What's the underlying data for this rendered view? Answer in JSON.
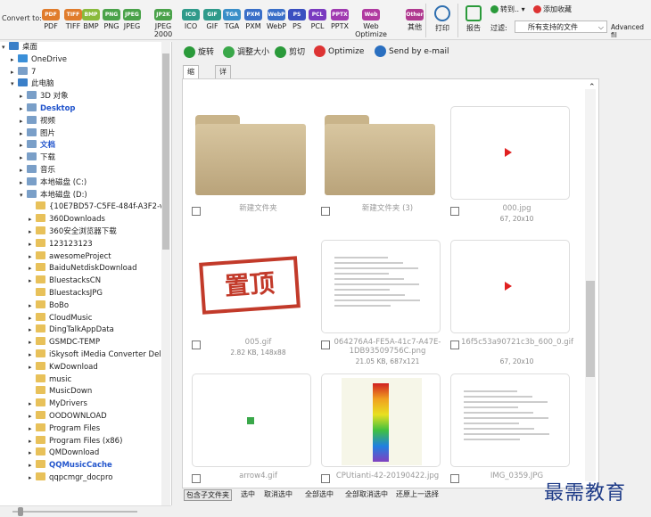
{
  "toolbar": {
    "convert_label": "Convert to:",
    "formats": [
      {
        "label": "PDF",
        "badge": "PDF",
        "color": "#e07c2c"
      },
      {
        "label": "TIFF",
        "badge": "TIFF",
        "color": "#e07c2c"
      },
      {
        "label": "BMP",
        "badge": "BMP",
        "color": "#8aba3c"
      },
      {
        "label": "PNG",
        "badge": "PNG",
        "color": "#4aa24a"
      },
      {
        "label": "JPEG",
        "badge": "JPEG",
        "color": "#4aa24a"
      },
      {
        "label": "JPEG 2000",
        "badge": "JP2K",
        "color": "#4aa24a"
      },
      {
        "label": "ICO",
        "badge": "ICO",
        "color": "#2f9a8a"
      },
      {
        "label": "GIF",
        "badge": "GIF",
        "color": "#2f9a8a"
      },
      {
        "label": "TGA",
        "badge": "TGA",
        "color": "#3a8fc8"
      },
      {
        "label": "PXM",
        "badge": "PXM",
        "color": "#3a6fc8"
      },
      {
        "label": "WebP",
        "badge": "WebP",
        "color": "#3a6fc8"
      },
      {
        "label": "PS",
        "badge": "PS",
        "color": "#3a4fc0"
      },
      {
        "label": "PCL",
        "badge": "PCL",
        "color": "#7a3ac0"
      },
      {
        "label": "PPTX",
        "badge": "PPTX",
        "color": "#a03ab0"
      },
      {
        "label": "Web Optimize",
        "badge": "Web",
        "color": "#b03aa0"
      },
      {
        "label": "其他",
        "badge": "Other",
        "color": "#b03a90"
      }
    ],
    "print_label": "打印",
    "report_label": "报告",
    "goto_label": "转到..",
    "favorite_label": "添加收藏",
    "filter_label": "过滤:",
    "filter_value": "所有支持的文件",
    "advanced_label": "Advanced fil"
  },
  "tree": {
    "items": [
      {
        "label": "桌面",
        "level": 0,
        "arrow": "▾",
        "color": "#222"
      },
      {
        "label": "OneDrive",
        "level": 1,
        "arrow": "▸",
        "color": "#222"
      },
      {
        "label": "7",
        "level": 1,
        "arrow": "▸",
        "color": "#222"
      },
      {
        "label": "此电脑",
        "level": 1,
        "arrow": "▾",
        "color": "#222"
      },
      {
        "label": "3D 对象",
        "level": 2,
        "arrow": "▸",
        "color": "#222"
      },
      {
        "label": "Desktop",
        "level": 2,
        "arrow": "▸",
        "color": "#2255cc"
      },
      {
        "label": "视频",
        "level": 2,
        "arrow": "▸",
        "color": "#222"
      },
      {
        "label": "图片",
        "level": 2,
        "arrow": "▸",
        "color": "#222"
      },
      {
        "label": "文档",
        "level": 2,
        "arrow": "▸",
        "color": "#2255cc"
      },
      {
        "label": "下载",
        "level": 2,
        "arrow": "▸",
        "color": "#222"
      },
      {
        "label": "音乐",
        "level": 2,
        "arrow": "▸",
        "color": "#222"
      },
      {
        "label": "本地磁盘 (C:)",
        "level": 2,
        "arrow": "▸",
        "color": "#222"
      },
      {
        "label": "本地磁盘 (D:)",
        "level": 2,
        "arrow": "▾",
        "color": "#222"
      },
      {
        "label": "{10E7BD57-C5FE-484f-A3F2-v",
        "level": 3,
        "arrow": "",
        "color": "#222"
      },
      {
        "label": "360Downloads",
        "level": 3,
        "arrow": "▸",
        "color": "#222"
      },
      {
        "label": "360安全浏览器下载",
        "level": 3,
        "arrow": "▸",
        "color": "#222"
      },
      {
        "label": "123123123",
        "level": 3,
        "arrow": "▸",
        "color": "#222"
      },
      {
        "label": "awesomeProject",
        "level": 3,
        "arrow": "▸",
        "color": "#222"
      },
      {
        "label": "BaiduNetdiskDownload",
        "level": 3,
        "arrow": "▸",
        "color": "#222"
      },
      {
        "label": "BluestacksCN",
        "level": 3,
        "arrow": "▸",
        "color": "#222"
      },
      {
        "label": "BluestacksJPG",
        "level": 3,
        "arrow": "",
        "color": "#222"
      },
      {
        "label": "BoBo",
        "level": 3,
        "arrow": "▸",
        "color": "#222"
      },
      {
        "label": "CloudMusic",
        "level": 3,
        "arrow": "▸",
        "color": "#222"
      },
      {
        "label": "DingTalkAppData",
        "level": 3,
        "arrow": "▸",
        "color": "#222"
      },
      {
        "label": "GSMDC-TEMP",
        "level": 3,
        "arrow": "▸",
        "color": "#222"
      },
      {
        "label": "iSkysoft iMedia Converter Delu",
        "level": 3,
        "arrow": "▸",
        "color": "#222"
      },
      {
        "label": "KwDownload",
        "level": 3,
        "arrow": "▸",
        "color": "#222"
      },
      {
        "label": "music",
        "level": 3,
        "arrow": "",
        "color": "#222"
      },
      {
        "label": "MusicDown",
        "level": 3,
        "arrow": "",
        "color": "#222"
      },
      {
        "label": "MyDrivers",
        "level": 3,
        "arrow": "▸",
        "color": "#222"
      },
      {
        "label": "OODOWNLOAD",
        "level": 3,
        "arrow": "▸",
        "color": "#222"
      },
      {
        "label": "Program Files",
        "level": 3,
        "arrow": "▸",
        "color": "#222"
      },
      {
        "label": "Program Files (x86)",
        "level": 3,
        "arrow": "▸",
        "color": "#222"
      },
      {
        "label": "QMDownload",
        "level": 3,
        "arrow": "▸",
        "color": "#222"
      },
      {
        "label": "QQMusicCache",
        "level": 3,
        "arrow": "▸",
        "color": "#2255cc"
      },
      {
        "label": "qqpcmgr_docpro",
        "level": 3,
        "arrow": "▸",
        "color": "#222"
      }
    ]
  },
  "actions": [
    {
      "label": "旋转",
      "color": "#2a9a3a"
    },
    {
      "label": "调整大小",
      "color": "#3aa84a"
    },
    {
      "label": "剪切",
      "color": "#2a9a3a"
    },
    {
      "label": "Optimize",
      "color": "#d33"
    },
    {
      "label": "Send by e-mail",
      "color": "#2a6fc0"
    }
  ],
  "tabs": [
    "缩略图",
    "详细信息"
  ],
  "gallery": [
    {
      "type": "folder",
      "caption": "新建文件夹",
      "sub": ""
    },
    {
      "type": "folder",
      "caption": "新建文件夹 (3)",
      "sub": ""
    },
    {
      "type": "play",
      "caption": "000.jpg",
      "sub": "67, 20x10"
    },
    {
      "type": "stamp",
      "caption": "005.gif",
      "sub": "2.82 KB, 148x88",
      "stamp_text": "置顶"
    },
    {
      "type": "doc",
      "caption": "064276A4-FE5A-41c7-A47E-1DB93509756C.png",
      "sub": "21.05 KB, 687x121"
    },
    {
      "type": "play",
      "caption": "16f5c53a90721c3b_600_0.gif",
      "sub": "67, 20x10"
    },
    {
      "type": "arrow",
      "caption": "arrow4.gif",
      "sub": ""
    },
    {
      "type": "chart",
      "caption": "CPUtianti-42-20190422.jpg",
      "sub": ""
    },
    {
      "type": "doc2",
      "caption": "IMG_0359.JPG",
      "sub": ""
    }
  ],
  "bottom_bar": [
    "包含子文件夹",
    "选中",
    "取消选中",
    "全部选中",
    "全部取消选中",
    "还原上一选择"
  ],
  "watermark": "最需教育"
}
